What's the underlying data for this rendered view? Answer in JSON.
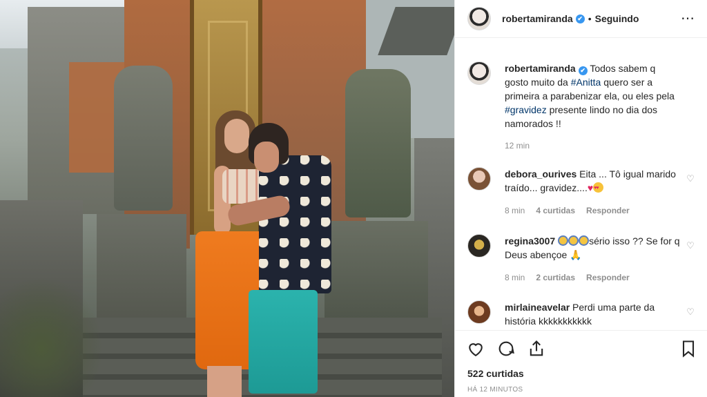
{
  "post_header": {
    "username": "robertamiranda",
    "verified_badge": "✔",
    "separator": "•",
    "follow_status": "Seguindo",
    "more_icon": "⋯"
  },
  "caption": {
    "username": "robertamiranda",
    "verified_badge": "✔",
    "text_part1": " Todos sabem q gosto muito da ",
    "hashtag1": "#Anitta",
    "text_part2": " quero ser a primeira a parabenizar ela, ou eles pela ",
    "hashtag2": "#gravidez",
    "text_part3": " presente lindo no dia dos namorados !!",
    "time": "12 min"
  },
  "comments": [
    {
      "username": "debora_ourives",
      "text": " Eita ... Tô igual marido traído... gravidez....",
      "time": "8 min",
      "likes": "4 curtidas",
      "reply": "Responder",
      "emojis": [
        "red-heart",
        "heart-eyes"
      ]
    },
    {
      "username": "regina3007",
      "text_after_emojis": "sério isso ?? Se for q Deus abençoe ",
      "time": "8 min",
      "likes": "2 curtidas",
      "reply": "Responder",
      "emojis": [
        "scream",
        "scream",
        "scream",
        "folded-hands"
      ]
    },
    {
      "username": "mirlaineavelar",
      "text": " Perdi uma parte da história kkkkkkkkkkk"
    }
  ],
  "actions": {
    "icons": [
      "heart-icon",
      "comment-icon",
      "share-icon",
      "bookmark-icon"
    ],
    "likes_count": "522 curtidas",
    "timestamp": "HÁ 12 MINUTOS"
  },
  "colors": {
    "accent_blue": "#3897f0",
    "hashtag": "#003569",
    "muted": "#8e8e8e",
    "text": "#262626"
  }
}
